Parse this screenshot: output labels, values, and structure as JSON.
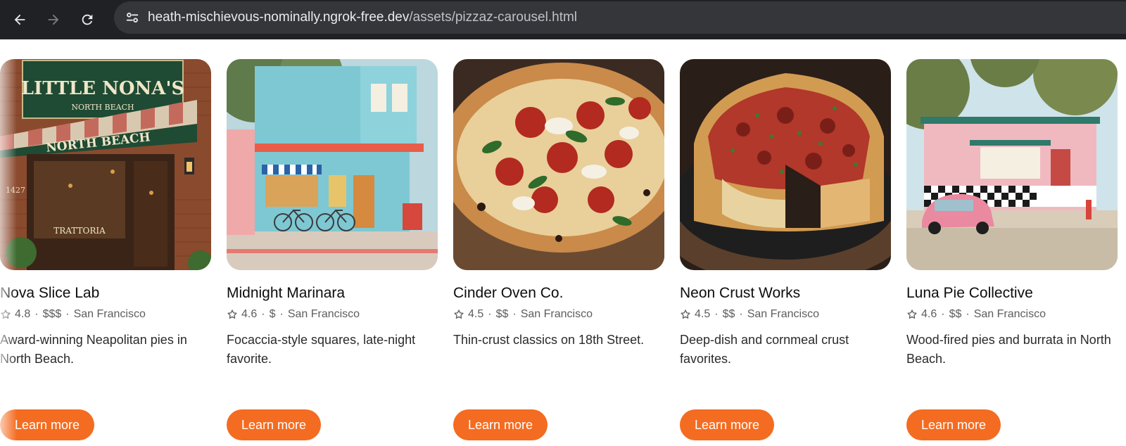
{
  "browser": {
    "url_host": "heath-mischievous-nominally.ngrok-free.dev",
    "url_path": "/assets/pizzaz-carousel.html",
    "icons": [
      "back-icon",
      "forward-icon",
      "reload-icon",
      "site-settings-icon"
    ]
  },
  "carousel": {
    "accent_color": "#f46c21",
    "cards": [
      {
        "name": "Nova Slice Lab",
        "rating": "4.8",
        "price": "$$$",
        "city": "San Francisco",
        "description": "Award-winning Neapolitan pies in North Beach.",
        "button": "Learn more",
        "image_sign_text": "LITTLE NONA'S",
        "image_sign_sub": "NORTH BEACH",
        "image_awning_text": "NORTH BEACH",
        "image_window_text": "TRATTORIA",
        "image_number": "1427"
      },
      {
        "name": "Midnight Marinara",
        "rating": "4.6",
        "price": "$",
        "city": "San Francisco",
        "description": "Focaccia-style squares, late-night favorite.",
        "button": "Learn more"
      },
      {
        "name": "Cinder Oven Co.",
        "rating": "4.5",
        "price": "$$",
        "city": "San Francisco",
        "description": "Thin-crust classics on 18th Street.",
        "button": "Learn more"
      },
      {
        "name": "Neon Crust Works",
        "rating": "4.5",
        "price": "$$",
        "city": "San Francisco",
        "description": "Deep-dish and cornmeal crust favorites.",
        "button": "Learn more"
      },
      {
        "name": "Luna Pie Collective",
        "rating": "4.6",
        "price": "$$",
        "city": "San Francisco",
        "description": "Wood-fired pies and burrata in North Beach.",
        "button": "Learn more"
      }
    ]
  }
}
